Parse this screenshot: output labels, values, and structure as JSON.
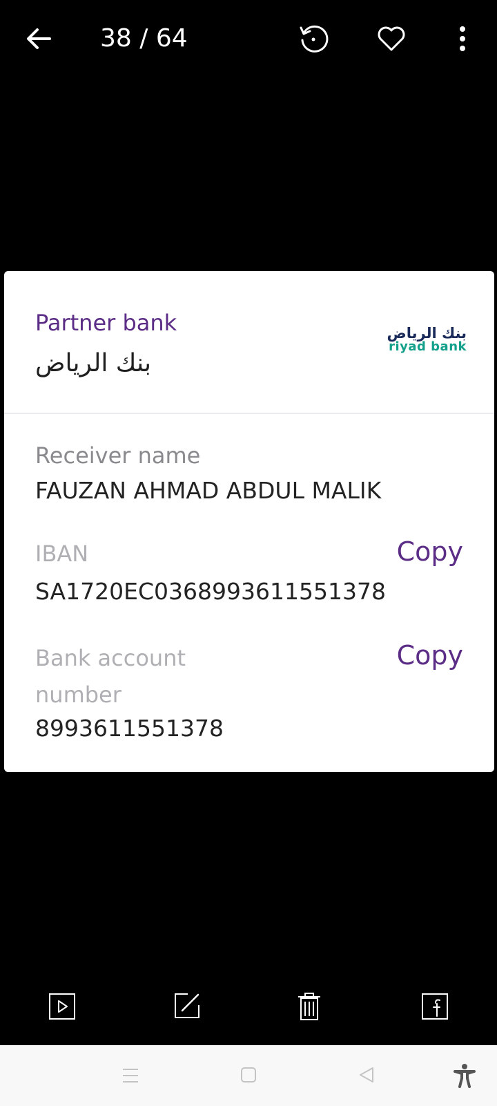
{
  "topbar": {
    "counter": "38 / 64",
    "icons": [
      "back-arrow-icon",
      "rotate-icon",
      "heart-icon",
      "more-vert-icon"
    ]
  },
  "card": {
    "partner_label": "Partner bank",
    "partner_name": "بنك الرياض",
    "logo": {
      "arabic": "بنك الرياض",
      "english": "riyad bank"
    },
    "receiver_label": "Receiver name",
    "receiver_value": "FAUZAN AHMAD ABDUL MALIK",
    "iban_label": "IBAN",
    "iban_value": "SA1720EC0368993611551378",
    "copy_label": "Copy",
    "account_label_line1": "Bank account",
    "account_label_line2": "number",
    "account_value": "8993611551378"
  },
  "bottombar": {
    "icons": [
      "play-icon",
      "edit-icon",
      "trash-icon",
      "facebook-icon"
    ]
  },
  "navbar": {
    "icons": [
      "recent-apps-icon",
      "home-icon",
      "back-icon",
      "accessibility-icon"
    ]
  },
  "colors": {
    "accent_purple": "#5b2d86",
    "logo_teal": "#12a08a",
    "logo_navy": "#1a2a5a",
    "background": "#000000"
  }
}
